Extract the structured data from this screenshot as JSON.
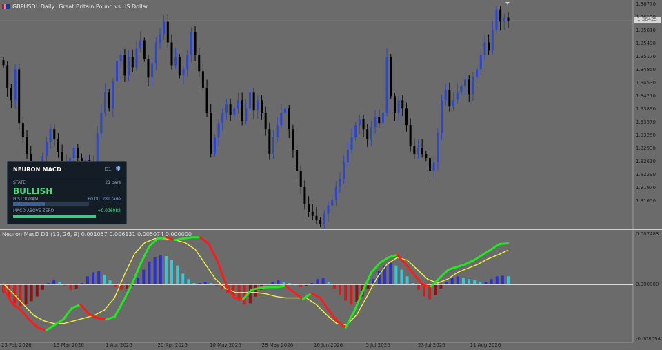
{
  "main": {
    "symbol": "GBPUSD!",
    "timeframe": "Daily:",
    "description": "Great Britain Pound vs US Dollar",
    "current_price": "1.36425",
    "price_ticks": [
      "1.36770",
      "1.36130",
      "1.35810",
      "1.35490",
      "1.35170",
      "1.34850",
      "1.34530",
      "1.34210",
      "1.33890",
      "1.33570",
      "1.33250",
      "1.32930",
      "1.32610",
      "1.32290",
      "1.31970",
      "1.31650"
    ]
  },
  "panel": {
    "title": "NEURON MACD",
    "timeframe": "D1",
    "state_label": "STATE",
    "bars": "21 bars",
    "state": "BULLISH",
    "histogram_label": "HISTOGRAM",
    "histogram_value": "+0.001281 fade",
    "histogram_fill": 0.42,
    "above_zero_label": "MACD ABOVE ZERO",
    "above_zero_value": "+0.006082",
    "above_zero_fill": 1.0
  },
  "indicator": {
    "label": "Neuron MacD D1 (12, 26, 9) 0.001057 0.006131 0.005074 0.000000",
    "ticks": [
      "0.007483",
      "0.000000",
      "-0.008094"
    ]
  },
  "dates": [
    "23 Feb 2026",
    "13 Mar 2026",
    "1 Apr 2026",
    "20 Apr 2026",
    "10 May 2026",
    "28 May 2026",
    "16 Jun 2026",
    "5 Jul 2026",
    "23 Jul 2026",
    "11 Aug 2026"
  ],
  "colors": {
    "background": "#6b6b6b",
    "bull_candle": "#2e46c8",
    "bear_candle": "#000000",
    "hist_pos_strong": "#2c2fcf",
    "hist_pos_weak": "#36c8d8",
    "hist_neg_strong": "#cc1f1f",
    "hist_neg_weak": "#8c1414",
    "macd_up": "#22e822",
    "macd_down": "#ff1a1a",
    "signal": "#f2f23a"
  },
  "chart_data": [
    {
      "type": "candlestick",
      "title": "GBPUSD!, Daily: Great Britain Pound vs US Dollar",
      "ylim": [
        1.3148,
        1.3686
      ],
      "closes": [
        1.3535,
        1.348,
        1.345,
        1.3525,
        1.3395,
        1.336,
        1.332,
        1.328,
        1.325,
        1.3285,
        1.3315,
        1.335,
        1.338,
        1.3355,
        1.3325,
        1.33,
        1.3285,
        1.331,
        1.3335,
        1.331,
        1.329,
        1.3305,
        1.328,
        1.33,
        1.337,
        1.342,
        1.347,
        1.343,
        1.3495,
        1.3545,
        1.356,
        1.351,
        1.3555,
        1.353,
        1.3575,
        1.3595,
        1.355,
        1.3505,
        1.354,
        1.359,
        1.361,
        1.364,
        1.359,
        1.3535,
        1.3555,
        1.351,
        1.3525,
        1.356,
        1.3615,
        1.356,
        1.352,
        1.348,
        1.342,
        1.332,
        1.336,
        1.3395,
        1.342,
        1.344,
        1.3415,
        1.343,
        1.345,
        1.34,
        1.343,
        1.347,
        1.3425,
        1.345,
        1.342,
        1.338,
        1.332,
        1.336,
        1.339,
        1.342,
        1.343,
        1.338,
        1.333,
        1.328,
        1.324,
        1.32,
        1.318,
        1.317,
        1.316,
        1.315,
        1.3175,
        1.3195,
        1.321,
        1.324,
        1.326,
        1.33,
        1.333,
        1.336,
        1.339,
        1.3405,
        1.338,
        1.3355,
        1.3385,
        1.341,
        1.3395,
        1.342,
        1.3555,
        1.346,
        1.342,
        1.345,
        1.343,
        1.339,
        1.334,
        1.332,
        1.3335,
        1.332,
        1.331,
        1.328,
        1.33,
        1.337,
        1.345,
        1.3475,
        1.3435,
        1.345,
        1.347,
        1.3485,
        1.35,
        1.3465,
        1.3505,
        1.3525,
        1.356,
        1.359,
        1.357,
        1.362,
        1.367,
        1.364,
        1.365,
        1.3642
      ]
    },
    {
      "type": "bar",
      "title": "Neuron MacD D1 (12, 26, 9)",
      "ylim": [
        -0.008094,
        0.007483
      ],
      "histogram": [
        -0.0012,
        -0.002,
        -0.0028,
        -0.0032,
        -0.003,
        -0.0025,
        -0.0018,
        -0.0008,
        0.0002,
        0.0006,
        0.0004,
        -0.0002,
        -0.0008,
        -0.0006,
        0.0002,
        0.0012,
        0.0018,
        0.002,
        0.0014,
        0.0006,
        -0.0004,
        -0.0008,
        -0.0006,
        -0.0002,
        0.001,
        0.0022,
        0.0034,
        0.004,
        0.0044,
        0.0042,
        0.0036,
        0.0028,
        0.0016,
        0.0008,
        0.0002,
        0.0002,
        0.0004,
        0.0002,
        -0.0002,
        -0.0006,
        -0.0012,
        -0.0018,
        -0.0024,
        -0.003,
        -0.0028,
        -0.0018,
        -0.0008,
        0.0,
        0.0004,
        0.0006,
        0.0004,
        0.0002,
        0.0,
        -0.0004,
        -0.0002,
        0.0002,
        0.0008,
        0.001,
        0.0004,
        -0.0006,
        -0.0016,
        -0.0024,
        -0.003,
        -0.0026,
        -0.0018,
        -0.0006,
        0.0008,
        0.002,
        0.0028,
        0.0032,
        0.0028,
        0.0022,
        0.0012,
        0.0002,
        -0.0008,
        -0.0018,
        -0.0022,
        -0.0016,
        -0.0006,
        0.0004,
        0.001,
        0.0012,
        0.001,
        0.0008,
        0.0006,
        0.0004,
        0.0004,
        0.0008,
        0.0012,
        0.0013,
        0.0012
      ],
      "macd": [
        -0.0005,
        -0.0028,
        -0.0038,
        -0.0052,
        -0.0064,
        -0.0068,
        -0.006,
        -0.0052,
        -0.0035,
        -0.003,
        -0.0044,
        -0.005,
        -0.0052,
        -0.0048,
        -0.0025,
        0.0,
        0.003,
        0.0056,
        0.0068,
        0.007,
        0.0066,
        0.0068,
        0.007,
        0.007,
        0.006,
        0.0035,
        0.0,
        -0.002,
        -0.0022,
        -0.0008,
        -0.0005,
        -0.0004,
        -0.0004,
        -0.0002,
        -0.0012,
        -0.0022,
        -0.0013,
        -0.002,
        -0.0038,
        -0.0055,
        -0.0064,
        -0.004,
        -0.001,
        0.0018,
        0.0032,
        0.004,
        0.0044,
        0.003,
        0.0015,
        -0.0001,
        -0.0003,
        0.001,
        0.0022,
        0.0026,
        0.003,
        0.0036,
        0.0044,
        0.0052,
        0.006,
        0.0061
      ],
      "signal": [
        0.0001,
        -0.0014,
        -0.003,
        -0.0046,
        -0.0054,
        -0.0058,
        -0.0058,
        -0.0054,
        -0.005,
        -0.0046,
        -0.0038,
        -0.002,
        0.0015,
        0.0046,
        0.0062,
        0.0068,
        0.0068,
        0.0066,
        0.0062,
        0.0052,
        0.003,
        0.0008,
        -0.0006,
        -0.0012,
        -0.0012,
        -0.0012,
        -0.0014,
        -0.0018,
        -0.002,
        -0.002,
        -0.002,
        -0.003,
        -0.0045,
        -0.0058,
        -0.006,
        -0.0045,
        -0.0018,
        0.001,
        0.003,
        0.004,
        0.0036,
        0.0022,
        0.0008,
        0.0002,
        0.0008,
        0.0018,
        0.0024,
        0.003,
        0.0038,
        0.0044,
        0.0051
      ]
    }
  ]
}
